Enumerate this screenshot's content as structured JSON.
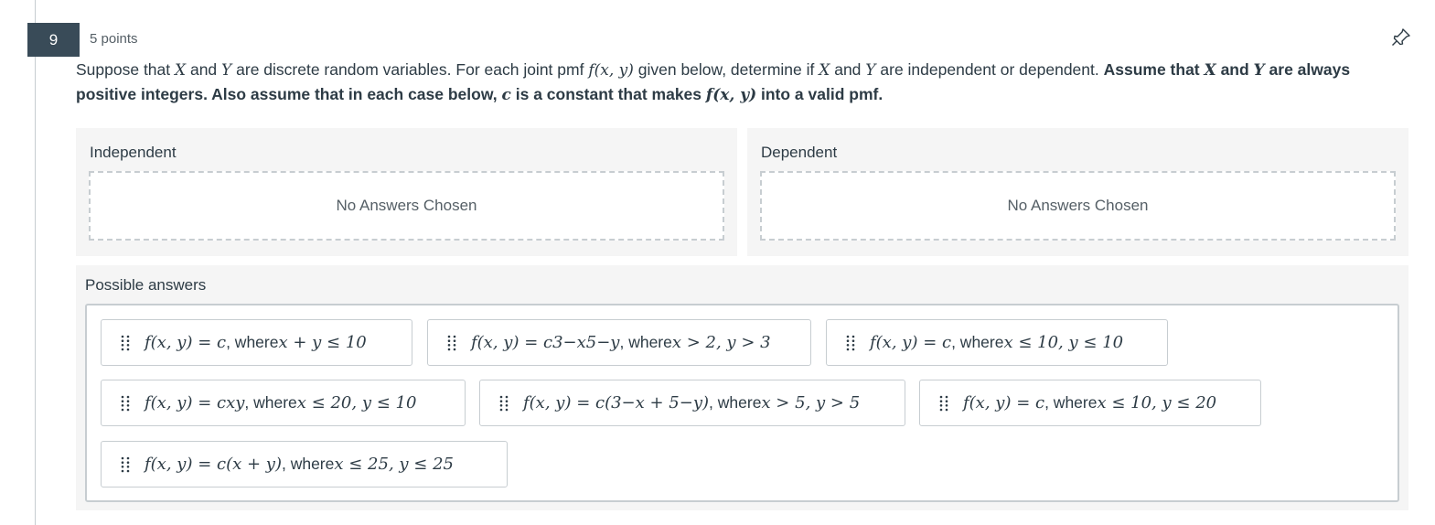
{
  "question": {
    "number": "9",
    "points": "5 points",
    "pin_icon": "pin-icon",
    "text_parts": [
      "Suppose that ",
      "X",
      " and ",
      "Y",
      " are discrete random variables. For each joint pmf ",
      "f(x, y)",
      " given below, determine if ",
      "X",
      " and ",
      "Y",
      " are independent or dependent. ",
      "Assume that ",
      "X",
      " and ",
      "Y",
      " are always positive integers. Also assume that in each case below, ",
      "c",
      " is a constant that makes ",
      "f(x, y)",
      " into a valid pmf."
    ]
  },
  "buckets": [
    {
      "title": "Independent",
      "placeholder": "No Answers Chosen"
    },
    {
      "title": "Dependent",
      "placeholder": "No Answers Chosen"
    }
  ],
  "answers": {
    "title": "Possible answers",
    "grip_icon": "drag-handle-icon",
    "items": [
      {
        "f": "f(x, y) = c",
        "sep": ", where ",
        "cond": "x + y ≤ 10"
      },
      {
        "f": "f(x, y) = c3−x5−y",
        "sep": ", where ",
        "cond": "x > 2, y > 3"
      },
      {
        "f": "f(x, y) = c",
        "sep": ", where ",
        "cond": "x ≤ 10, y ≤ 10"
      },
      {
        "f": "f(x, y) = cxy",
        "sep": ", where ",
        "cond": "x ≤ 20, y ≤ 10"
      },
      {
        "f": "f(x, y) = c(3−x + 5−y)",
        "sep": ", where ",
        "cond": "x > 5, y > 5"
      },
      {
        "f": "f(x, y) = c",
        "sep": ", where ",
        "cond": "x ≤ 10, y ≤ 20"
      },
      {
        "f": "f(x, y) = c(x + y)",
        "sep": ", where ",
        "cond": "x ≤ 25, y ≤ 25"
      }
    ]
  },
  "colors": {
    "question_number_bg": "#394b58",
    "panel_bg": "#f5f5f5",
    "border": "#c7cdd1",
    "text": "#2d3b45",
    "muted_text": "#555f66"
  }
}
